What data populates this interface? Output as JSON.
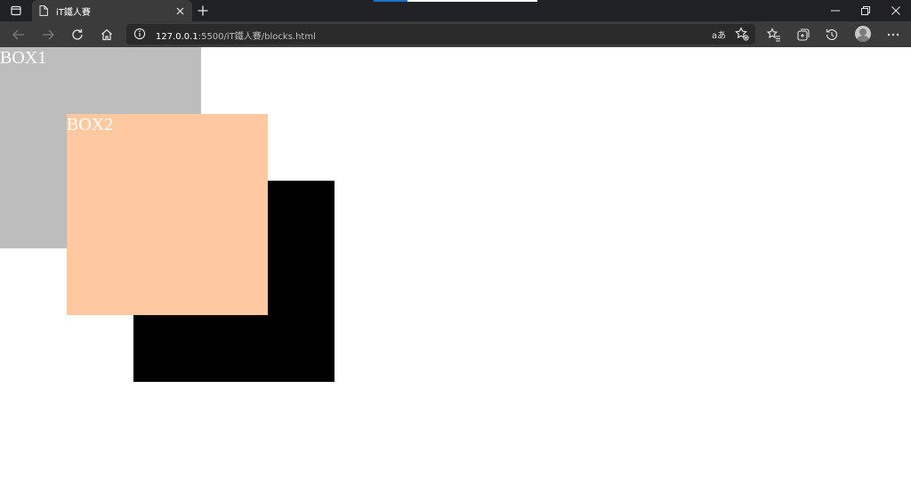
{
  "browser": {
    "tab_title": "iT鐵人賽",
    "url_host": "127.0.0.1",
    "url_rest": ":5500/iT鐵人賽/blocks.html",
    "read_aloud_label": "aあ"
  },
  "page": {
    "boxes": [
      {
        "label": "BOX1",
        "color": "#bdbdbd"
      },
      {
        "label": "BOX2",
        "color": "#fec8a0"
      },
      {
        "label": "",
        "color": "#000000"
      }
    ]
  },
  "colors": {
    "chrome_dark": "#202124",
    "toolbar": "#3b3b3b",
    "address_bg": "#2a2a2b"
  }
}
